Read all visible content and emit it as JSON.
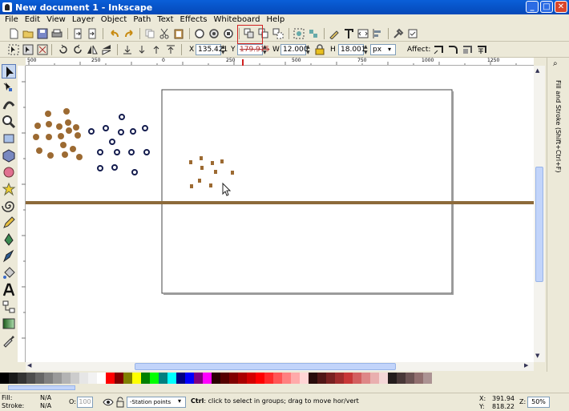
{
  "window": {
    "title": "New document 1 - Inkscape",
    "min": "_",
    "max": "□",
    "close": "✕"
  },
  "menu": [
    "File",
    "Edit",
    "View",
    "Layer",
    "Object",
    "Path",
    "Text",
    "Effects",
    "Whiteboard",
    "Help"
  ],
  "toolbar2": {
    "x_label": "X",
    "x_value": "135.421",
    "y_label": "Y",
    "y_value": "179.915",
    "w_label": "W",
    "w_value": "12.000",
    "h_label": "H",
    "h_value": "18.001",
    "unit": "px",
    "affect_label": "Affect:"
  },
  "ruler": {
    "ticks": [
      "500",
      "250",
      "0",
      "250",
      "500",
      "750",
      "1000",
      "1250"
    ]
  },
  "dock": {
    "label": "Fill and Stroke (Shift+Ctrl+F)"
  },
  "status": {
    "fill_label": "Fill:",
    "fill_value": "N/A",
    "stroke_label": "Stroke:",
    "stroke_value": "N/A",
    "opacity_label": "O:",
    "opacity_value": "100",
    "layer": "-Station points",
    "message_bold": "Ctrl",
    "message": ": click to select in groups; drag to move hor/vert",
    "x_label": "X:",
    "x_value": "391.94",
    "y_label": "Y:",
    "y_value": "818.22",
    "zoom_label": "Z:",
    "zoom_value": "50%"
  },
  "colors": {
    "brown": "#9c6a32",
    "navy": "#141c4e",
    "line": "#8c6a3a",
    "highlight": "#d02020"
  }
}
